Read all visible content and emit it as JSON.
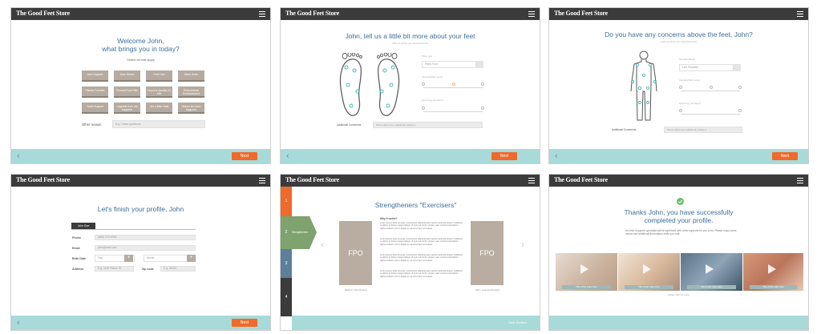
{
  "brand": "The Good Feet Store",
  "next_label": "Next",
  "panel1": {
    "title_line1": "Welcome John,",
    "title_line2": "what brings you in today?",
    "subtitle": "Select all that apply",
    "tiles": [
      "Arch Support",
      "Sore Shoes",
      "Feet Hurt",
      "Back Hurts",
      "Plantar Fasciitis",
      "Prevent Foot Pain",
      "Improve Quality Of Life",
      "Performance Enhancement",
      "Youth Support",
      "Upgrade from old supports",
      "Get a Bike Seat",
      "Return for more supports"
    ],
    "other_label": "Other reason",
    "other_placeholder": "E.g. I have questions"
  },
  "panel2": {
    "title": "John, tell us a little bit more about your feet",
    "subtitle": "Click on where you feel discomfort",
    "field1_label": "Shoe size",
    "field1_placeholder": "Right Foot",
    "field2_label": "Intensity/Pain Level",
    "field3_label": "How long, est days?",
    "comments_label": "Additional Comments",
    "comments_placeholder": "Tell us about any additional problems"
  },
  "panel3": {
    "title": "Do you have any concerns above the feet, John?",
    "subtitle": "Click on where you feel discomfort",
    "field1_label": "Shoulder/Neck",
    "field1_placeholder": "Left Shoulder",
    "field2_label": "Intensity/Pain Level",
    "field3_label": "How long, est days?",
    "comments_label": "Additional Comments",
    "comments_placeholder": "Tell us about any additional problems"
  },
  "panel4": {
    "title": "Let's finish your profile, John",
    "name_tag": "John Doe",
    "phone_label": "Phone",
    "phone_value": "(888) 270-9908",
    "email_label": "Email",
    "email_value": "john@mail.com",
    "birth_label": "Birth Date",
    "birth_day": "Day",
    "birth_month": "Month",
    "address_label": "Address",
    "address_placeholder": "E.g. 1199 Pierce St",
    "zip_label": "Zip code",
    "zip_placeholder": "E.g. 80110"
  },
  "panel5": {
    "title": "Strengtheners \"Exercisers\"",
    "steps": [
      "1",
      "2",
      "3",
      "4"
    ],
    "active_step_label": "Strengtheners",
    "why_label": "Why it works?",
    "lorem": "Lorem ipsum dolor sit amet, consectetur adipiscing elit, sed do eiusmod tempor incididunt ut labore et dolore magna aliqua. Ut enim ad minim veniam, quis nostrud exercitation ullamco laboris nisi ut aliquip ex ea commodo consequat.",
    "fpo": "FPO",
    "left_caption": "Without / Prior Product",
    "right_caption": "With / Improved Product",
    "next_section": "Next Section"
  },
  "panel6": {
    "title_line1": "Thanks John, you have successfully",
    "title_line2": "completed your profile.",
    "body": "An Arch Supports specialist will be right back with a few supports for you to try. Please enjoy some videos and additional information while you wait.",
    "video_caption": "Title of the video here",
    "swipe_hint": "Swipe right for more"
  },
  "colors": {
    "accent": "#ef6a2b",
    "teal": "#a8dad9",
    "title_blue": "#3d6f9c",
    "topbar": "#3b3b3b",
    "tile": "#b6aba1"
  }
}
